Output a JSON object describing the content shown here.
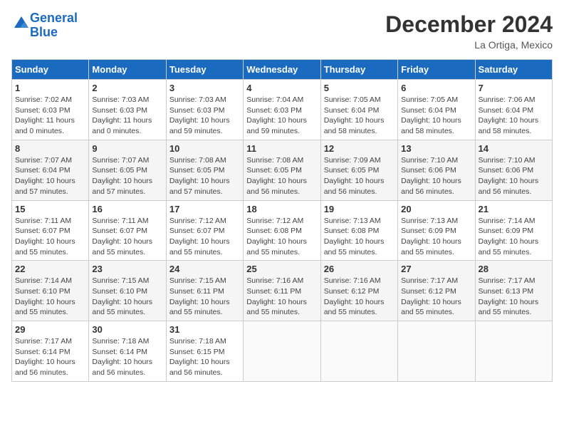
{
  "header": {
    "logo_line1": "General",
    "logo_line2": "Blue",
    "month": "December 2024",
    "location": "La Ortiga, Mexico"
  },
  "weekdays": [
    "Sunday",
    "Monday",
    "Tuesday",
    "Wednesday",
    "Thursday",
    "Friday",
    "Saturday"
  ],
  "weeks": [
    [
      {
        "day": "1",
        "sunrise": "7:02 AM",
        "sunset": "6:03 PM",
        "daylight": "11 hours and 0 minutes."
      },
      {
        "day": "2",
        "sunrise": "7:03 AM",
        "sunset": "6:03 PM",
        "daylight": "11 hours and 0 minutes."
      },
      {
        "day": "3",
        "sunrise": "7:03 AM",
        "sunset": "6:03 PM",
        "daylight": "10 hours and 59 minutes."
      },
      {
        "day": "4",
        "sunrise": "7:04 AM",
        "sunset": "6:03 PM",
        "daylight": "10 hours and 59 minutes."
      },
      {
        "day": "5",
        "sunrise": "7:05 AM",
        "sunset": "6:04 PM",
        "daylight": "10 hours and 58 minutes."
      },
      {
        "day": "6",
        "sunrise": "7:05 AM",
        "sunset": "6:04 PM",
        "daylight": "10 hours and 58 minutes."
      },
      {
        "day": "7",
        "sunrise": "7:06 AM",
        "sunset": "6:04 PM",
        "daylight": "10 hours and 58 minutes."
      }
    ],
    [
      {
        "day": "8",
        "sunrise": "7:07 AM",
        "sunset": "6:04 PM",
        "daylight": "10 hours and 57 minutes."
      },
      {
        "day": "9",
        "sunrise": "7:07 AM",
        "sunset": "6:05 PM",
        "daylight": "10 hours and 57 minutes."
      },
      {
        "day": "10",
        "sunrise": "7:08 AM",
        "sunset": "6:05 PM",
        "daylight": "10 hours and 57 minutes."
      },
      {
        "day": "11",
        "sunrise": "7:08 AM",
        "sunset": "6:05 PM",
        "daylight": "10 hours and 56 minutes."
      },
      {
        "day": "12",
        "sunrise": "7:09 AM",
        "sunset": "6:05 PM",
        "daylight": "10 hours and 56 minutes."
      },
      {
        "day": "13",
        "sunrise": "7:10 AM",
        "sunset": "6:06 PM",
        "daylight": "10 hours and 56 minutes."
      },
      {
        "day": "14",
        "sunrise": "7:10 AM",
        "sunset": "6:06 PM",
        "daylight": "10 hours and 56 minutes."
      }
    ],
    [
      {
        "day": "15",
        "sunrise": "7:11 AM",
        "sunset": "6:07 PM",
        "daylight": "10 hours and 55 minutes."
      },
      {
        "day": "16",
        "sunrise": "7:11 AM",
        "sunset": "6:07 PM",
        "daylight": "10 hours and 55 minutes."
      },
      {
        "day": "17",
        "sunrise": "7:12 AM",
        "sunset": "6:07 PM",
        "daylight": "10 hours and 55 minutes."
      },
      {
        "day": "18",
        "sunrise": "7:12 AM",
        "sunset": "6:08 PM",
        "daylight": "10 hours and 55 minutes."
      },
      {
        "day": "19",
        "sunrise": "7:13 AM",
        "sunset": "6:08 PM",
        "daylight": "10 hours and 55 minutes."
      },
      {
        "day": "20",
        "sunrise": "7:13 AM",
        "sunset": "6:09 PM",
        "daylight": "10 hours and 55 minutes."
      },
      {
        "day": "21",
        "sunrise": "7:14 AM",
        "sunset": "6:09 PM",
        "daylight": "10 hours and 55 minutes."
      }
    ],
    [
      {
        "day": "22",
        "sunrise": "7:14 AM",
        "sunset": "6:10 PM",
        "daylight": "10 hours and 55 minutes."
      },
      {
        "day": "23",
        "sunrise": "7:15 AM",
        "sunset": "6:10 PM",
        "daylight": "10 hours and 55 minutes."
      },
      {
        "day": "24",
        "sunrise": "7:15 AM",
        "sunset": "6:11 PM",
        "daylight": "10 hours and 55 minutes."
      },
      {
        "day": "25",
        "sunrise": "7:16 AM",
        "sunset": "6:11 PM",
        "daylight": "10 hours and 55 minutes."
      },
      {
        "day": "26",
        "sunrise": "7:16 AM",
        "sunset": "6:12 PM",
        "daylight": "10 hours and 55 minutes."
      },
      {
        "day": "27",
        "sunrise": "7:17 AM",
        "sunset": "6:12 PM",
        "daylight": "10 hours and 55 minutes."
      },
      {
        "day": "28",
        "sunrise": "7:17 AM",
        "sunset": "6:13 PM",
        "daylight": "10 hours and 55 minutes."
      }
    ],
    [
      {
        "day": "29",
        "sunrise": "7:17 AM",
        "sunset": "6:14 PM",
        "daylight": "10 hours and 56 minutes."
      },
      {
        "day": "30",
        "sunrise": "7:18 AM",
        "sunset": "6:14 PM",
        "daylight": "10 hours and 56 minutes."
      },
      {
        "day": "31",
        "sunrise": "7:18 AM",
        "sunset": "6:15 PM",
        "daylight": "10 hours and 56 minutes."
      },
      null,
      null,
      null,
      null
    ]
  ]
}
